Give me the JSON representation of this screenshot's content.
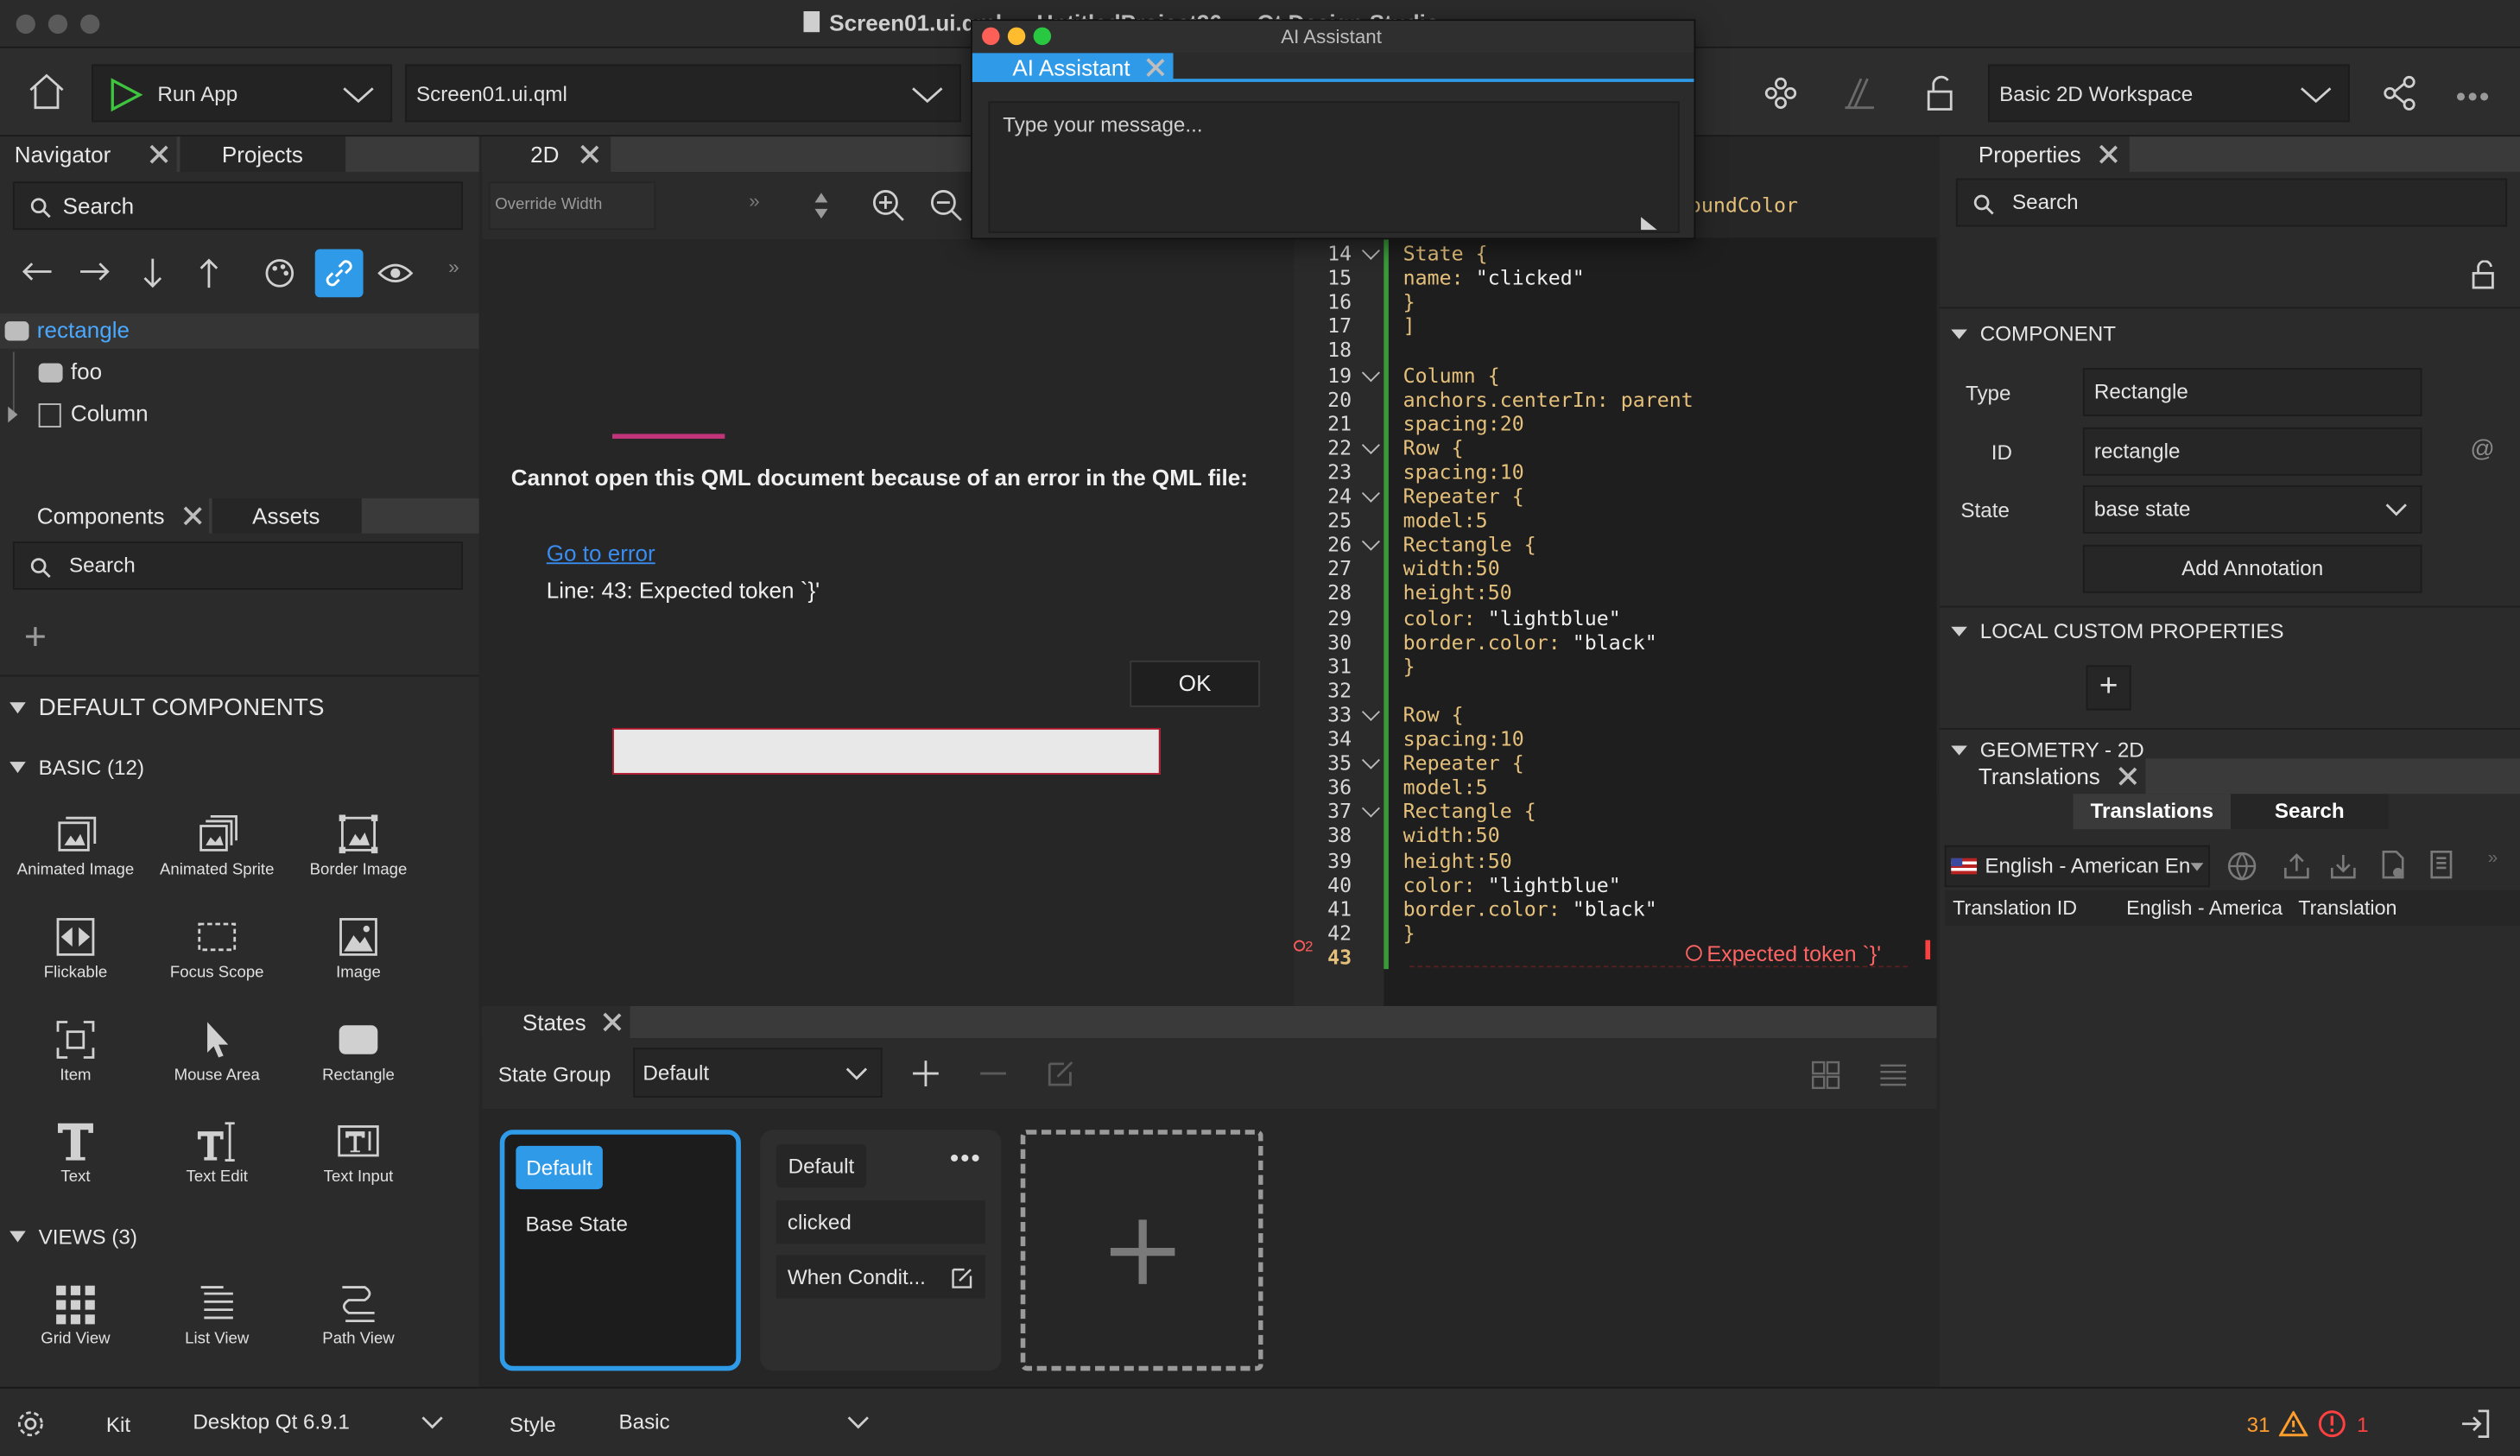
{
  "window": {
    "title": "Screen01.ui.qml — UntitledProject36 — Qt Design Studio"
  },
  "toolbar": {
    "run_label": "Run App",
    "file_label": "Screen01.ui.qml",
    "workspace_label": "Basic 2D Workspace"
  },
  "navigator": {
    "tab": "Navigator",
    "tab2": "Projects",
    "search": "Search",
    "tree": [
      {
        "label": "rectangle"
      },
      {
        "label": "foo"
      },
      {
        "label": "Column"
      }
    ]
  },
  "components": {
    "tab": "Components",
    "tab2": "Assets",
    "search": "Search",
    "default_header": "DEFAULT COMPONENTS",
    "basic_header": "BASIC (12)",
    "basic": [
      "Animated Image",
      "Animated Sprite",
      "Border Image",
      "Flickable",
      "Focus Scope",
      "Image",
      "Item",
      "Mouse Area",
      "Rectangle",
      "Text",
      "Text Edit",
      "Text Input"
    ],
    "views_header": "VIEWS (3)",
    "views": [
      "Grid View",
      "List View",
      "Path View"
    ]
  },
  "editor2d": {
    "tab": "2D",
    "override": "Override Width",
    "error_title": "Cannot open this QML document because of an error in the QML file:",
    "go_to_error": "Go to error",
    "error_line": "Line: 43: Expected token `}'",
    "ok": "OK"
  },
  "code": {
    "partial_top": "oundColor",
    "line_numbers": [
      "14",
      "15",
      "16",
      "17",
      "18",
      "19",
      "20",
      "21",
      "22",
      "23",
      "24",
      "25",
      "26",
      "27",
      "28",
      "29",
      "30",
      "31",
      "32",
      "33",
      "34",
      "35",
      "36",
      "37",
      "38",
      "39",
      "40",
      "41",
      "42",
      "43"
    ],
    "lines": [
      {
        "t": "State {"
      },
      {
        "t": "name: ",
        "s": "\"clicked\""
      },
      {
        "t": "}"
      },
      {
        "t": "]"
      },
      {
        "t": ""
      },
      {
        "t": "Column {"
      },
      {
        "t": "anchors.centerIn: parent"
      },
      {
        "t": "spacing:20"
      },
      {
        "t": "Row {"
      },
      {
        "t": "spacing:10"
      },
      {
        "t": "Repeater {"
      },
      {
        "t": "model:5"
      },
      {
        "t": "Rectangle {"
      },
      {
        "t": "width:50"
      },
      {
        "t": "height:50"
      },
      {
        "t": "color: ",
        "s": "\"lightblue\""
      },
      {
        "t": "border.color: ",
        "s": "\"black\""
      },
      {
        "t": "}"
      },
      {
        "t": ""
      },
      {
        "t": "Row {"
      },
      {
        "t": "spacing:10"
      },
      {
        "t": "Repeater {"
      },
      {
        "t": "model:5"
      },
      {
        "t": "Rectangle {"
      },
      {
        "t": "width:50"
      },
      {
        "t": "height:50"
      },
      {
        "t": "color: ",
        "s": "\"lightblue\""
      },
      {
        "t": "border.color: ",
        "s": "\"black\""
      },
      {
        "t": "}"
      },
      {
        "t": ""
      }
    ],
    "error_count": "2",
    "error_msg": "Expected token `}'"
  },
  "ai": {
    "title": "AI Assistant",
    "tab": "AI Assistant",
    "placeholder": "Type your message..."
  },
  "properties": {
    "tab": "Properties",
    "search": "Search",
    "component_header": "COMPONENT",
    "type_label": "Type",
    "type_value": "Rectangle",
    "id_label": "ID",
    "id_value": "rectangle",
    "state_label": "State",
    "state_value": "base state",
    "add_annotation": "Add Annotation",
    "local_header": "LOCAL CUSTOM PROPERTIES",
    "geometry_header": "GEOMETRY - 2D"
  },
  "translations": {
    "tab": "Translations",
    "btn1": "Translations",
    "btn2": "Search",
    "language": "English - American En",
    "col1": "Translation ID",
    "col2": "English - America",
    "col3": "Translation"
  },
  "states": {
    "tab": "States",
    "group_label": "State Group",
    "group_value": "Default",
    "base_badge": "Default",
    "base_label": "Base State",
    "s2_badge": "Default",
    "s2_name": "clicked",
    "s2_when": "When Condit..."
  },
  "statusbar": {
    "kit_label": "Kit",
    "kit_value": "Desktop Qt 6.9.1",
    "style_label": "Style",
    "style_value": "Basic",
    "warnings": "31",
    "errors": "1"
  },
  "colors": {
    "accent": "#2f9ae8",
    "error": "#ff5a5a",
    "warning": "#ff9e2c",
    "link": "#3a8df0",
    "code_keyword": "#e5c07b"
  }
}
